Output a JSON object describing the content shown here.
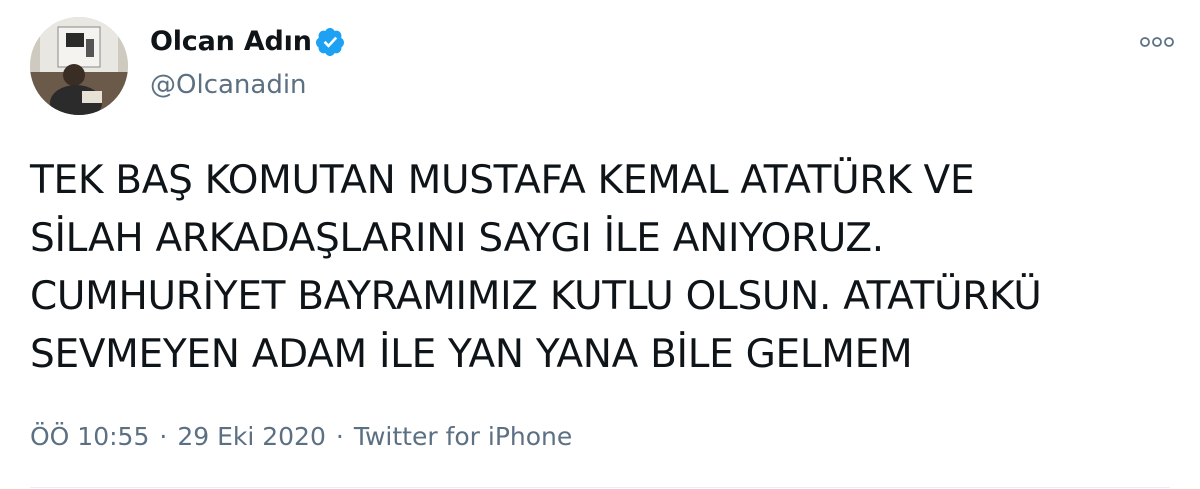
{
  "author": {
    "display_name": "Olcan Adın",
    "handle": "@Olcanadin",
    "verified": true
  },
  "icons": {
    "verified": "verified-badge-icon",
    "more": "more-options-icon",
    "verified_color": "#1da1f2"
  },
  "tweet": {
    "text": "TEK BAŞ KOMUTAN MUSTAFA KEMAL ATATÜRK VE\nSİLAH ARKADAŞLARINI SAYGI İLE ANIYORUZ.\nCUMHURİYET BAYRAMIMIZ KUTLU OLSUN. ATATÜRKÜ\nSEVMEYEN ADAM İLE YAN YANA BİLE GELMEM",
    "time": "ÖÖ 10:55",
    "separator": "·",
    "date": "29 Eki 2020",
    "source": "Twitter for iPhone"
  },
  "colors": {
    "text": "#0f1419",
    "secondary": "#5b7083"
  }
}
